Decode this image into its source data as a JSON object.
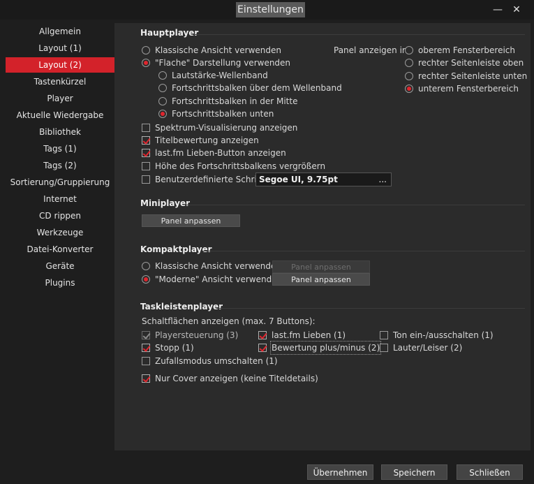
{
  "window": {
    "title": "Einstellungen",
    "minimize": "—",
    "close": "✕"
  },
  "sidebar": {
    "items": [
      "Allgemein",
      "Layout (1)",
      "Layout (2)",
      "Tastenkürzel",
      "Player",
      "Aktuelle Wiedergabe",
      "Bibliothek",
      "Tags (1)",
      "Tags (2)",
      "Sortierung/Gruppierung",
      "Internet",
      "CD rippen",
      "Werkzeuge",
      "Datei-Konverter",
      "Geräte",
      "Plugins"
    ],
    "active_index": 2
  },
  "hauptplayer": {
    "title": "Hauptplayer",
    "view_classic": "Klassische Ansicht verwenden",
    "view_flat": "\"Flache\" Darstellung verwenden",
    "sub_options": [
      "Lautstärke-Wellenband",
      "Fortschrittsbalken über dem Wellenband",
      "Fortschrittsbalken in der Mitte",
      "Fortschrittsbalken unten"
    ],
    "panel_label": "Panel anzeigen in:",
    "panel_options": [
      "oberem Fensterbereich",
      "rechter Seitenleiste oben",
      "rechter Seitenleiste unten",
      "unterem Fensterbereich"
    ],
    "checkboxes": [
      "Spektrum-Visualisierung anzeigen",
      "Titelbewertung anzeigen",
      "last.fm Lieben-Button anzeigen",
      "Höhe des Fortschrittsbalkens vergrößern",
      "Benutzerdefinierte Schrift:"
    ],
    "font_value": "Segoe UI, 9.75pt",
    "font_browse": "..."
  },
  "miniplayer": {
    "title": "Miniplayer",
    "button": "Panel anpassen"
  },
  "kompaktplayer": {
    "title": "Kompaktplayer",
    "view_classic": "Klassische Ansicht verwenden",
    "view_modern": "\"Moderne\" Ansicht verwenden",
    "button": "Panel anpassen"
  },
  "taskleistenplayer": {
    "title": "Taskleistenplayer",
    "buttons_label": "Schaltflächen anzeigen (max. 7 Buttons):",
    "col1": [
      "Playersteuerung (3)",
      "Stopp (1)",
      "Zufallsmodus umschalten (1)"
    ],
    "col2": [
      "last.fm Lieben (1)",
      "Bewertung plus/minus (2)"
    ],
    "col3": [
      "Ton ein-/ausschalten (1)",
      "Lauter/Leiser (2)"
    ],
    "cover_only": "Nur Cover anzeigen (keine Titeldetails)"
  },
  "footer": {
    "apply": "Übernehmen",
    "save": "Speichern",
    "close": "Schließen"
  },
  "colors": {
    "accent": "#d3222a",
    "panel": "#2b2b2b",
    "background": "#1e1e1e"
  }
}
